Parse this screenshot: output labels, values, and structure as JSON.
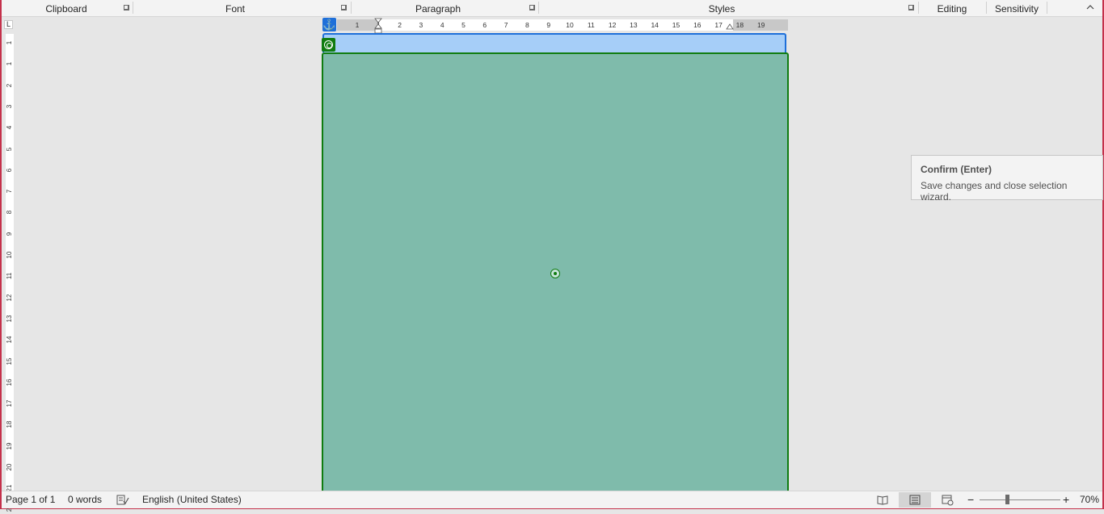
{
  "ribbon": {
    "groups": [
      "Clipboard",
      "Font",
      "Paragraph",
      "Styles",
      "Editing",
      "Sensitivity"
    ]
  },
  "rulers": {
    "horizontal_numbers": [
      "1",
      "1",
      "2",
      "3",
      "4",
      "5",
      "6",
      "7",
      "8",
      "9",
      "10",
      "11",
      "12",
      "13",
      "14",
      "15",
      "16",
      "17",
      "18",
      "19"
    ],
    "vertical_numbers": [
      "1",
      "1",
      "2",
      "3",
      "4",
      "5",
      "6",
      "7",
      "8",
      "9",
      "10",
      "11",
      "12",
      "13",
      "14",
      "15",
      "16",
      "17",
      "18",
      "19",
      "20",
      "21",
      "2"
    ]
  },
  "tooltip": {
    "title": "Confirm (Enter)",
    "description": "Save changes and close selection wizard."
  },
  "statusbar": {
    "page": "Page 1 of 1",
    "words": "0 words",
    "language": "English (United States)",
    "zoom": "70%",
    "zoom_level_percent": 70
  },
  "colors": {
    "accent_blue": "#1e6fd9",
    "selection_green": "#107c10",
    "shape_fill": "#7fbbab",
    "header_fill": "#a6cef8",
    "frame_red": "#c4314b"
  },
  "icons": {
    "anchor": "anchor-icon",
    "shape": "shape-target-icon",
    "center": "center-point-icon",
    "proofing": "proofing-icon",
    "read_mode": "read-mode-icon",
    "print_layout": "print-layout-icon",
    "web_layout": "web-layout-icon"
  }
}
